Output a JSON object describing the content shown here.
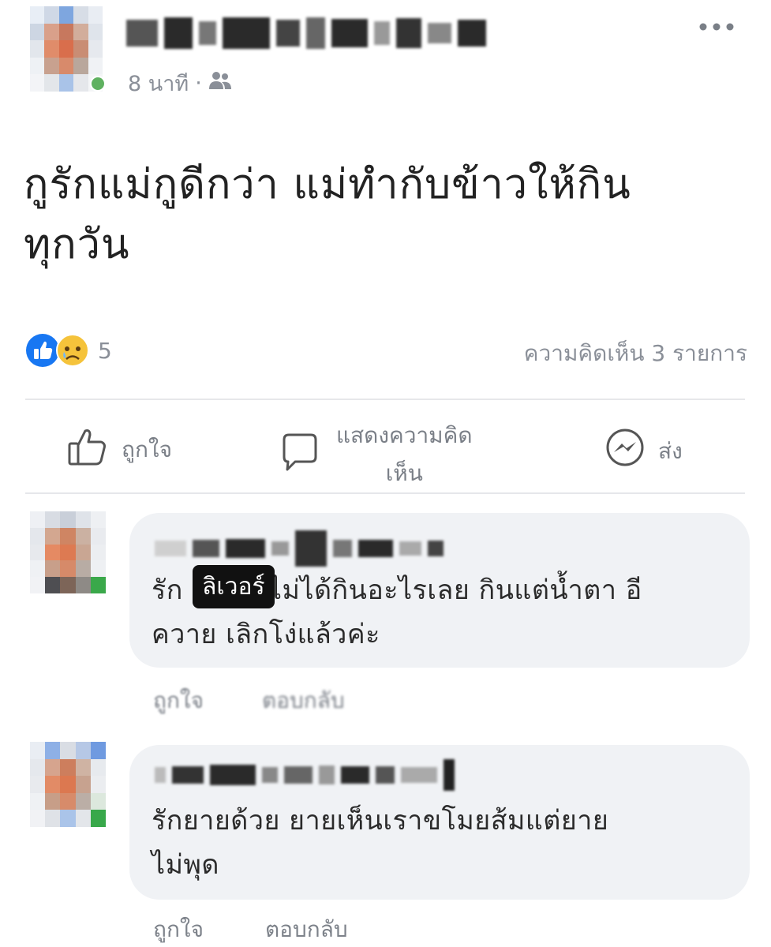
{
  "post": {
    "time_text": "8 นาที",
    "separator": "·",
    "audience_icon": "friends-icon",
    "more_icon": "ellipsis-icon",
    "body_line1": "กูรักแม่กูดีกว่า แม่ทำกับข้าวให้กิน",
    "body_line2": "ทุกวัน",
    "reactions": {
      "icons": [
        "like-reaction-icon",
        "sad-reaction-icon"
      ],
      "count": "5"
    },
    "comment_count_text": "ความคิดเห็น 3 รายการ"
  },
  "actions": {
    "like_label": "ถูกใจ",
    "comment_label_line1": "แสดงความคิด",
    "comment_label_line2": "เห็น",
    "share_label": "ส่ง"
  },
  "comments": [
    {
      "text_prefix": "รัก",
      "sticker_label": "ลิเวอร์",
      "text_line1_rest": "ไม่ได้กินอะไรเลย กินแต่น้ำตา อี",
      "text_line2": "ควาย เลิกโง่แล้วค่ะ",
      "like_label": "ถูกใจ",
      "reply_label": "ตอบกลับ"
    },
    {
      "text_line1": "รักยายด้วย ยายเห็นเราขโมยส้มแต่ยาย",
      "text_line2": "ไม่พุด",
      "like_label": "ถูกใจ",
      "reply_label": "ตอบกลับ"
    }
  ],
  "colors": {
    "like_blue": "#1877f2",
    "sad_yellow": "#f5c33b",
    "bubble_gray": "#f0f2f5",
    "online_green": "#5fb160"
  }
}
